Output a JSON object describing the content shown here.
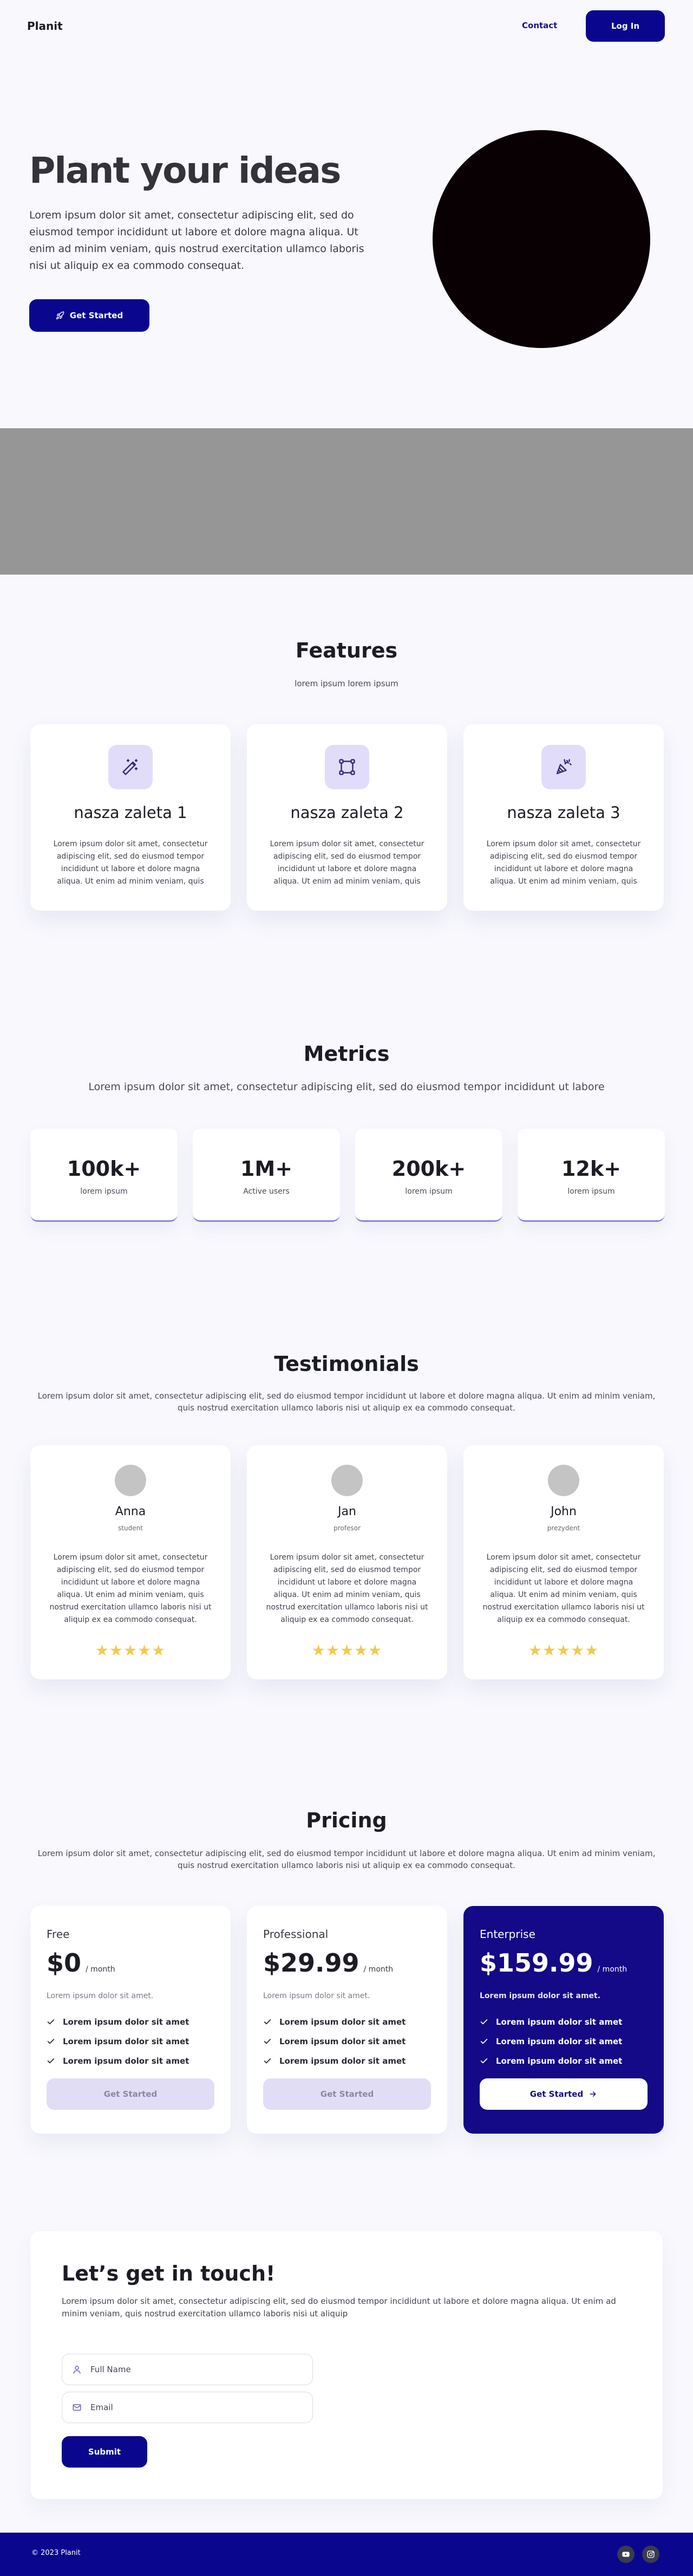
{
  "header": {
    "logo": "Planit",
    "nav_contact": "Contact",
    "login_label": "Log In"
  },
  "hero": {
    "title": "Plant your ideas",
    "text": "Lorem ipsum dolor sit amet, consectetur adipiscing elit, sed do eiusmod tempor incididunt ut labore et dolore magna aliqua. Ut enim ad minim veniam, quis nostrud exercitation ullamco laboris nisi ut aliquip ex ea commodo consequat.",
    "cta_label": "Get Started",
    "cta_icon": "rocket-icon"
  },
  "features": {
    "title": "Features",
    "subtitle": "lorem ipsum lorem ipsum",
    "items": [
      {
        "icon": "magic-wand-icon",
        "title": "nasza zaleta 1",
        "text": "Lorem ipsum dolor sit amet, consectetur adipiscing elit, sed do eiusmod tempor incididunt ut labore et dolore magna aliqua. Ut enim ad minim veniam, quis"
      },
      {
        "icon": "vector-nodes-icon",
        "title": "nasza zaleta 2",
        "text": "Lorem ipsum dolor sit amet, consectetur adipiscing elit, sed do eiusmod tempor incididunt ut labore et dolore magna aliqua. Ut enim ad minim veniam, quis"
      },
      {
        "icon": "party-popper-icon",
        "title": "nasza zaleta 3",
        "text": "Lorem ipsum dolor sit amet, consectetur adipiscing elit, sed do eiusmod tempor incididunt ut labore et dolore magna aliqua. Ut enim ad minim veniam, quis"
      }
    ]
  },
  "metrics": {
    "title": "Metrics",
    "subtitle": "Lorem ipsum dolor sit amet, consectetur adipiscing elit, sed do eiusmod tempor incididunt ut labore",
    "items": [
      {
        "value": "100k+",
        "label": "lorem ipsum"
      },
      {
        "value": "1M+",
        "label": "Active users"
      },
      {
        "value": "200k+",
        "label": "lorem ipsum"
      },
      {
        "value": "12k+",
        "label": "lorem ipsum"
      }
    ]
  },
  "testimonials": {
    "title": "Testimonials",
    "subtitle": "Lorem ipsum dolor sit amet, consectetur adipiscing elit, sed do eiusmod tempor incididunt ut labore et dolore magna aliqua. Ut enim ad minim veniam, quis nostrud exercitation ullamco laboris nisi ut aliquip ex ea commodo consequat.",
    "items": [
      {
        "name": "Anna",
        "role": "student",
        "text": "Lorem ipsum dolor sit amet, consectetur adipiscing elit, sed do eiusmod tempor incididunt ut labore et dolore magna aliqua. Ut enim ad minim veniam, quis nostrud exercitation ullamco laboris nisi ut aliquip ex ea commodo consequat.",
        "rating": 5
      },
      {
        "name": "Jan",
        "role": "profesor",
        "text": "Lorem ipsum dolor sit amet, consectetur adipiscing elit, sed do eiusmod tempor incididunt ut labore et dolore magna aliqua. Ut enim ad minim veniam, quis nostrud exercitation ullamco laboris nisi ut aliquip ex ea commodo consequat.",
        "rating": 5
      },
      {
        "name": "John",
        "role": "prezydent",
        "text": "Lorem ipsum dolor sit amet, consectetur adipiscing elit, sed do eiusmod tempor incididunt ut labore et dolore magna aliqua. Ut enim ad minim veniam, quis nostrud exercitation ullamco laboris nisi ut aliquip ex ea commodo consequat.",
        "rating": 5
      }
    ]
  },
  "pricing": {
    "title": "Pricing",
    "subtitle": "Lorem ipsum dolor sit amet, consectetur adipiscing elit, sed do eiusmod tempor incididunt ut labore et dolore magna aliqua. Ut enim ad minim veniam, quis nostrud exercitation ullamco laboris nisi ut aliquip ex ea commodo consequat.",
    "plans": [
      {
        "name": "Free",
        "price": "$0",
        "per": "/ month",
        "desc": "Lorem ipsum dolor sit amet.",
        "features": [
          "Lorem ipsum dolor sit amet",
          "Lorem ipsum dolor sit amet",
          "Lorem ipsum dolor sit amet"
        ],
        "button": "Get Started"
      },
      {
        "name": "Professional",
        "price": "$29.99",
        "per": "/ month",
        "desc": "Lorem ipsum dolor sit amet.",
        "features": [
          "Lorem ipsum dolor sit amet",
          "Lorem ipsum dolor sit amet",
          "Lorem ipsum dolor sit amet"
        ],
        "button": "Get Started"
      },
      {
        "name": "Enterprise",
        "price": "$159.99",
        "per": "/ month",
        "desc": "Lorem ipsum dolor sit amet.",
        "features": [
          "Lorem ipsum dolor sit amet",
          "Lorem ipsum dolor sit amet",
          "Lorem ipsum dolor sit amet"
        ],
        "button": "Get Started"
      }
    ]
  },
  "contact": {
    "title": "Let’s get in touch!",
    "text": "Lorem ipsum dolor sit amet, consectetur adipiscing elit, sed do eiusmod tempor incididunt ut labore et dolore magna aliqua. Ut enim ad minim veniam, quis nostrud exercitation ullamco laboris nisi ut aliquip",
    "name_placeholder": "Full Name",
    "email_placeholder": "Email",
    "submit_label": "Submit"
  },
  "footer": {
    "copyright": "© 2023 Planit",
    "social_icons": [
      "youtube-icon",
      "instagram-icon"
    ]
  },
  "colors": {
    "primary": "#0a078e",
    "featured_plan": "#140986",
    "icon_bg": "#e2dcfb",
    "star": "#f2c94c",
    "banner": "#969696"
  }
}
